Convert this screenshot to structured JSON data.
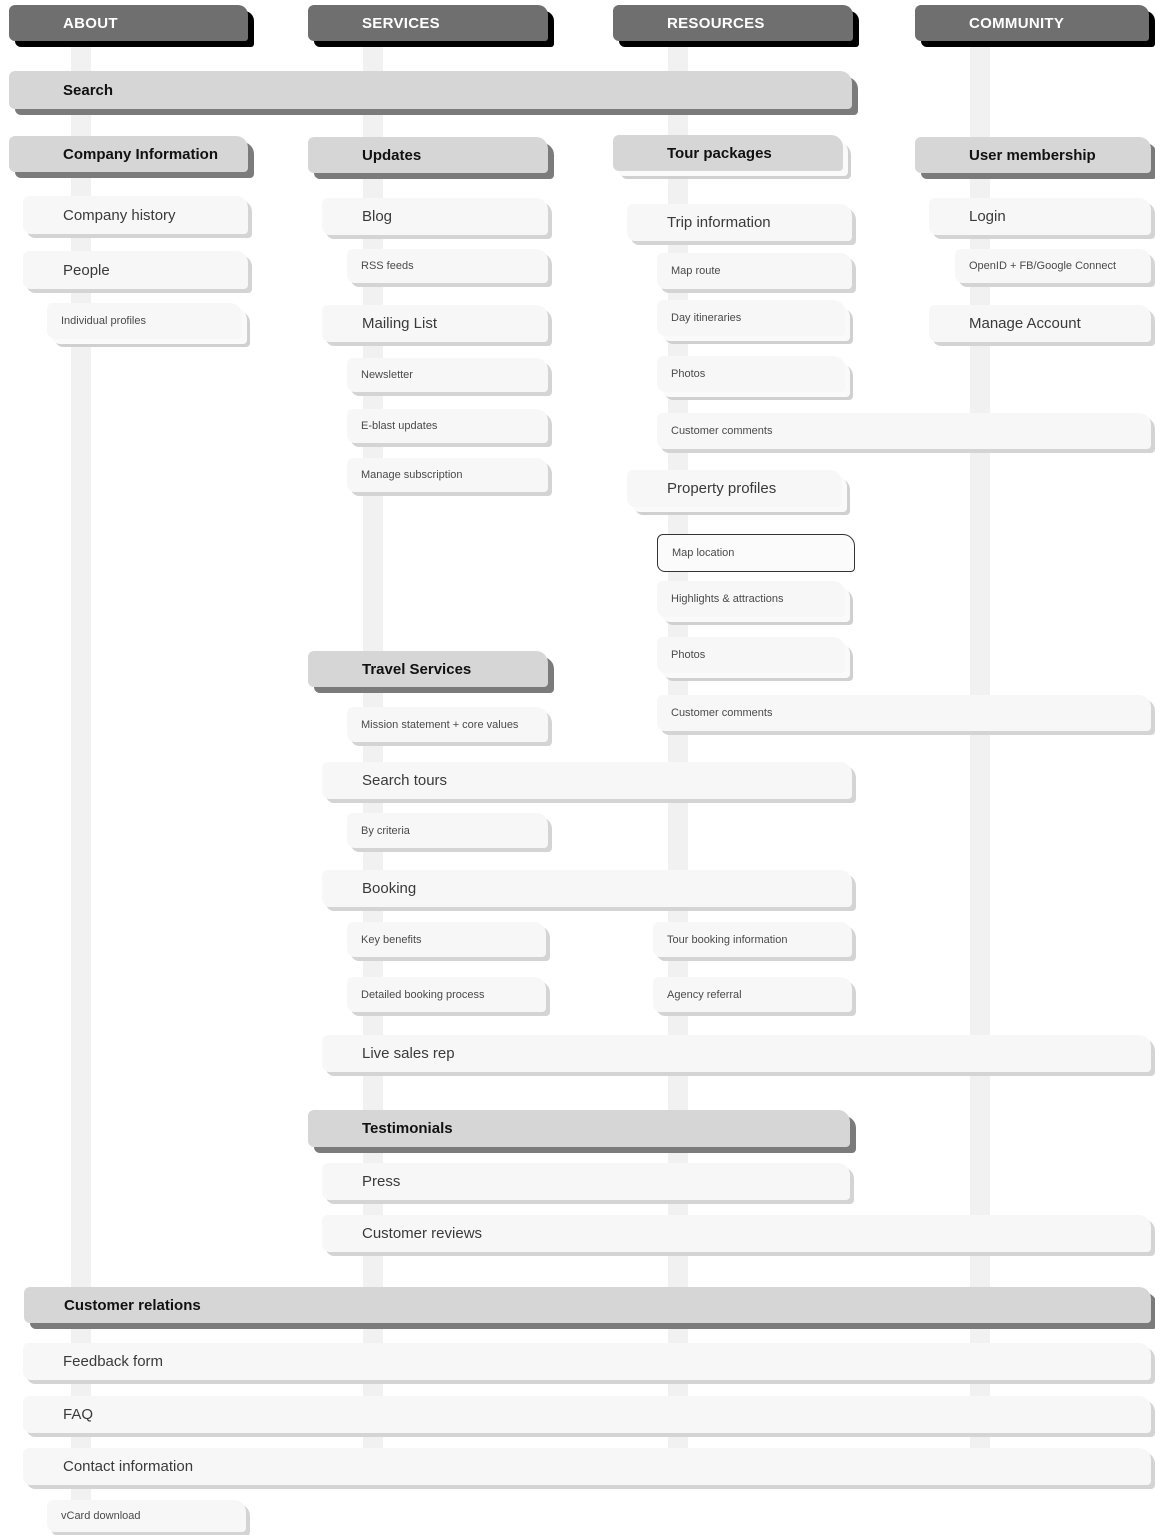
{
  "columns": {
    "about": "ABOUT",
    "services": "SERVICES",
    "resources": "RESOURCES",
    "community": "COMMUNITY"
  },
  "search": "Search",
  "about": {
    "company_information": "Company Information",
    "company_history": "Company history",
    "people": "People",
    "individual_profiles": "Individual profiles"
  },
  "services": {
    "updates": "Updates",
    "blog": "Blog",
    "rss_feeds": "RSS feeds",
    "mailing_list": "Mailing List",
    "newsletter": "Newsletter",
    "eblast_updates": "E-blast updates",
    "manage_subscription": "Manage subscription",
    "travel_services": "Travel Services",
    "mission_statement": "Mission statement + core values",
    "search_tours": "Search tours",
    "by_criteria": "By criteria",
    "booking": "Booking",
    "key_benefits": "Key benefits",
    "detailed_booking_process": "Detailed booking process",
    "tour_booking_information": "Tour booking information",
    "agency_referral": "Agency referral",
    "live_sales_rep": "Live sales rep",
    "testimonials": "Testimonials",
    "press": "Press",
    "customer_reviews": "Customer reviews"
  },
  "resources": {
    "tour_packages": "Tour packages",
    "trip_information": "Trip information",
    "map_route": "Map route",
    "day_itineraries": "Day itineraries",
    "photos_trip": "Photos",
    "customer_comments_trip": "Customer comments",
    "property_profiles": "Property profiles",
    "map_location": "Map location",
    "highlights_attractions": "Highlights & attractions",
    "photos_property": "Photos",
    "customer_comments_property": "Customer comments"
  },
  "community": {
    "user_membership": "User membership",
    "login": "Login",
    "openid_connect": "OpenID + FB/Google Connect",
    "manage_account": "Manage Account"
  },
  "customer_relations": {
    "title": "Customer relations",
    "feedback_form": "Feedback form",
    "faq": "FAQ",
    "contact_information": "Contact information",
    "vcard_download": "vCard download"
  }
}
